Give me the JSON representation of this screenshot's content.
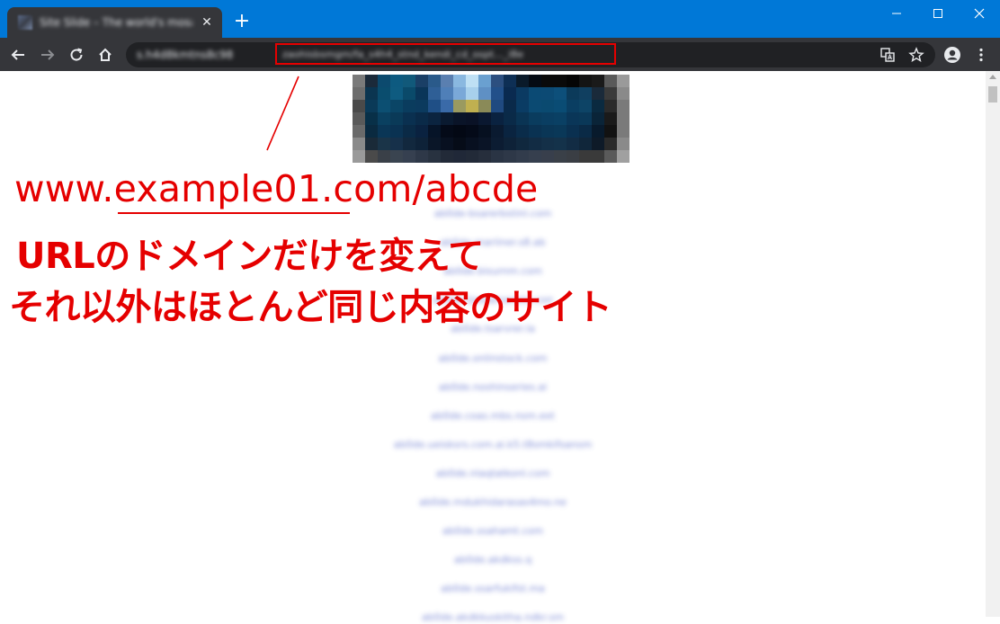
{
  "browser": {
    "tab": {
      "title": "Site Slide – The world's mosaic",
      "close_glyph": "✕"
    },
    "new_tab_glyph": "+",
    "window_controls": {
      "minimize": "—",
      "maximize": "☐",
      "close": "✕"
    },
    "toolbar": {
      "origin": "s.h4d8kmtns8c98",
      "path": "zaohisbsmgm/fa_s4h4_stnd_kendi_cd_ospt..._i8e"
    }
  },
  "page": {
    "links": [
      "ab0de-bsarerbstinl.com",
      "ab0de-mariiner.s8.ab",
      "ab0de.bisurnm.com",
      "ab0de.tjeelamenste.com",
      "ab0de.tsarvrer.la",
      "ab0de.onlinstock.com",
      "ab0de.noshinseries.ai",
      "ab0de.coas.mbs.nsm.ext",
      "ab0de.ueisksrs.com.ai.k5.t8smkifsansm",
      "ab0de.nlaqtatkonl.com",
      "ab0de.mdukhidarasas4mo.ne",
      "ab0de.ssahamt.com",
      "ab0de.akdkss.q",
      "ab0de.ssarfukifst.ma",
      "ab0de.akdkkuskitha.ndkr.sm"
    ]
  },
  "annotation": {
    "url_prefix": "www.",
    "url_domain": "example01",
    "url_suffix": ".com/abcde",
    "line1": "URLのドメインだけを変えて",
    "line2": "それ以外はほとんど同じ内容のサイト",
    "color": "#e50000"
  },
  "colors": {
    "titlebar": "#0078d7",
    "toolbar": "#35363a",
    "omnibox": "#202124",
    "annotation_red": "#e50000",
    "link_blue": "#5567c9"
  }
}
